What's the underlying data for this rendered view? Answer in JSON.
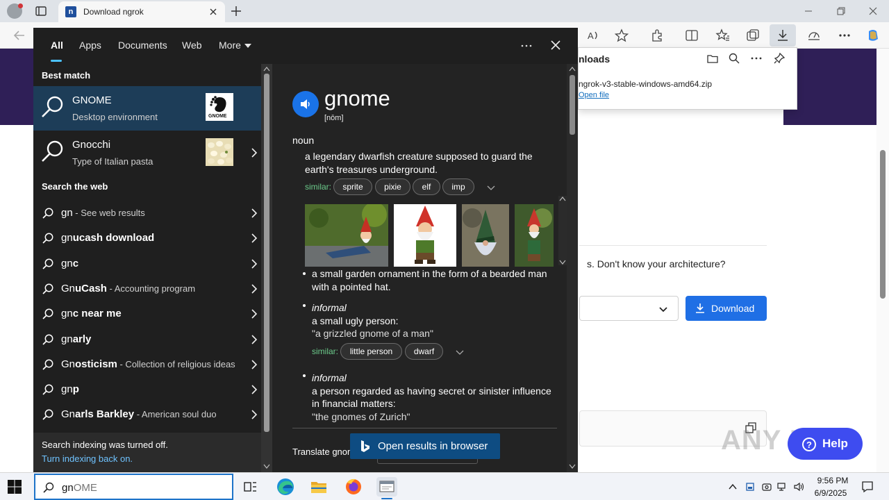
{
  "browser": {
    "tab_title": "Download ngrok",
    "favicon_letter": "n"
  },
  "downloads_panel": {
    "title": "nloads",
    "file_name": "ngrok-v3-stable-windows-amd64.zip",
    "open_link": "Open file"
  },
  "page": {
    "arch_text": "s. Don't know your architecture?",
    "download_label": "Download",
    "watermark": "ANY RUN",
    "help_label": "Help"
  },
  "search": {
    "tabs": {
      "all": "All",
      "apps": "Apps",
      "documents": "Documents",
      "web": "Web",
      "more": "More"
    },
    "best_match_label": "Best match",
    "best_match": {
      "title": "GNOME",
      "subtitle": "Desktop environment",
      "logo_text": "GNOME"
    },
    "second_match": {
      "title": "Gnocchi",
      "subtitle": "Type of Italian pasta"
    },
    "search_web_label": "Search the web",
    "web_results": [
      {
        "bold": "gn",
        "rest": "",
        "sub": " - See web results"
      },
      {
        "bold": "gn",
        "rest": "ucash download",
        "sub": ""
      },
      {
        "bold": "gn",
        "rest": "c",
        "sub": ""
      },
      {
        "bold": "Gn",
        "rest": "uCash",
        "sub": " - Accounting program"
      },
      {
        "bold": "gn",
        "rest": "c near me",
        "sub": ""
      },
      {
        "bold": "gn",
        "rest": "arly",
        "sub": ""
      },
      {
        "bold": "Gn",
        "rest": "osticism",
        "sub": " - Collection of religious ideas"
      },
      {
        "bold": "gn",
        "rest": "p",
        "sub": ""
      },
      {
        "bold": "Gn",
        "rest": "arls Barkley",
        "sub": " - American soul duo"
      }
    ],
    "indexing_msg": "Search indexing was turned off.",
    "indexing_link": "Turn indexing back on.",
    "typed_query": "gn",
    "autocomplete": "OME"
  },
  "preview": {
    "word": "gnome",
    "pronunciation": "[nōm]",
    "part_of_speech": "noun",
    "def1_line1": "a legendary dwarfish creature supposed to guard the",
    "def1_line2": "earth's treasures underground.",
    "similar_label": "similar:",
    "similar1": [
      "sprite",
      "pixie",
      "elf",
      "imp"
    ],
    "def2_line1": "a small garden ornament in the form of a bearded man",
    "def2_line2": "with a pointed hat.",
    "def3_tag": "informal",
    "def3_line1": "a small ugly person:",
    "def3_example": "\"a grizzled gnome of a man\"",
    "similar2": [
      "little person",
      "dwarf"
    ],
    "def4_tag": "informal",
    "def4_line1": "a person regarded as having secret or sinister influence",
    "def4_line2": "in financial matters:",
    "def4_example": "\"the gnomes of Zurich\"",
    "translate_label": "Translate gnome",
    "open_browser_label": "Open results in browser"
  },
  "taskbar": {
    "time": "9:56 PM",
    "date": "6/9/2025"
  },
  "colors": {
    "accent": "#1d73c9",
    "selected_row": "#1d3d58",
    "similar_green": "#6ccb8b",
    "link_blue": "#6fc3ff",
    "open_browser_bg": "#0e4c82"
  },
  "icons": [
    "search-icon",
    "gnome-logo",
    "chevron-right-icon",
    "speaker-icon",
    "bing-icon",
    "close-icon",
    "more-options-icon",
    "windows-start-icon",
    "edge-icon",
    "file-explorer-icon",
    "firefox-icon",
    "download-icon",
    "help-icon",
    "copy-icon"
  ]
}
